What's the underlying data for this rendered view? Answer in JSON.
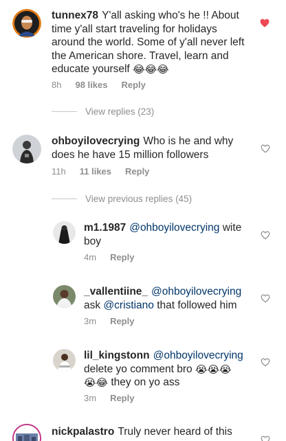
{
  "colors": {
    "text": "#262626",
    "muted": "#8e8e8e",
    "mention": "#003569",
    "liked_heart": "#ed4956",
    "unliked_heart": "#8e8e8e"
  },
  "comments": [
    {
      "username": "tunnex78",
      "text": "Y'all asking who's he !! About time y'all start traveling for holidays around the world. Some of y'all never left the American shore. Travel, learn and educate yourself",
      "emoji": "😂😂😂",
      "time": "8h",
      "likes": "98 likes",
      "reply": "Reply",
      "liked": true,
      "heart_icon": "heart-filled-icon",
      "view_replies": "View replies (23)"
    },
    {
      "username": "ohboyilovecrying",
      "text": "Who is he and why does he have 15 million followers",
      "time": "11h",
      "likes": "11 likes",
      "reply": "Reply",
      "liked": false,
      "heart_icon": "heart-outline-icon",
      "view_replies": "View previous replies (45)"
    }
  ],
  "replies": [
    {
      "username": "m1.1987",
      "mention": "@ohboyilovecrying",
      "text": "wite boy",
      "time": "4m",
      "reply": "Reply"
    },
    {
      "username": "_vallentiine_",
      "mention": "@ohboyilovecrying",
      "text_before": "ask",
      "mention2": "@cristiano",
      "text_after": "that followed him",
      "time": "3m",
      "reply": "Reply"
    },
    {
      "username": "lil_kingstonn",
      "mention": "@ohboyilovecrying",
      "text": "delete yo comment bro",
      "emoji1": "😭😭😭",
      "emoji2": "😭😂",
      "text2": "they on yo ass",
      "time": "3m",
      "reply": "Reply"
    }
  ],
  "last_comment": {
    "username": "nickpalastro",
    "text": "Truly never heard of this"
  }
}
